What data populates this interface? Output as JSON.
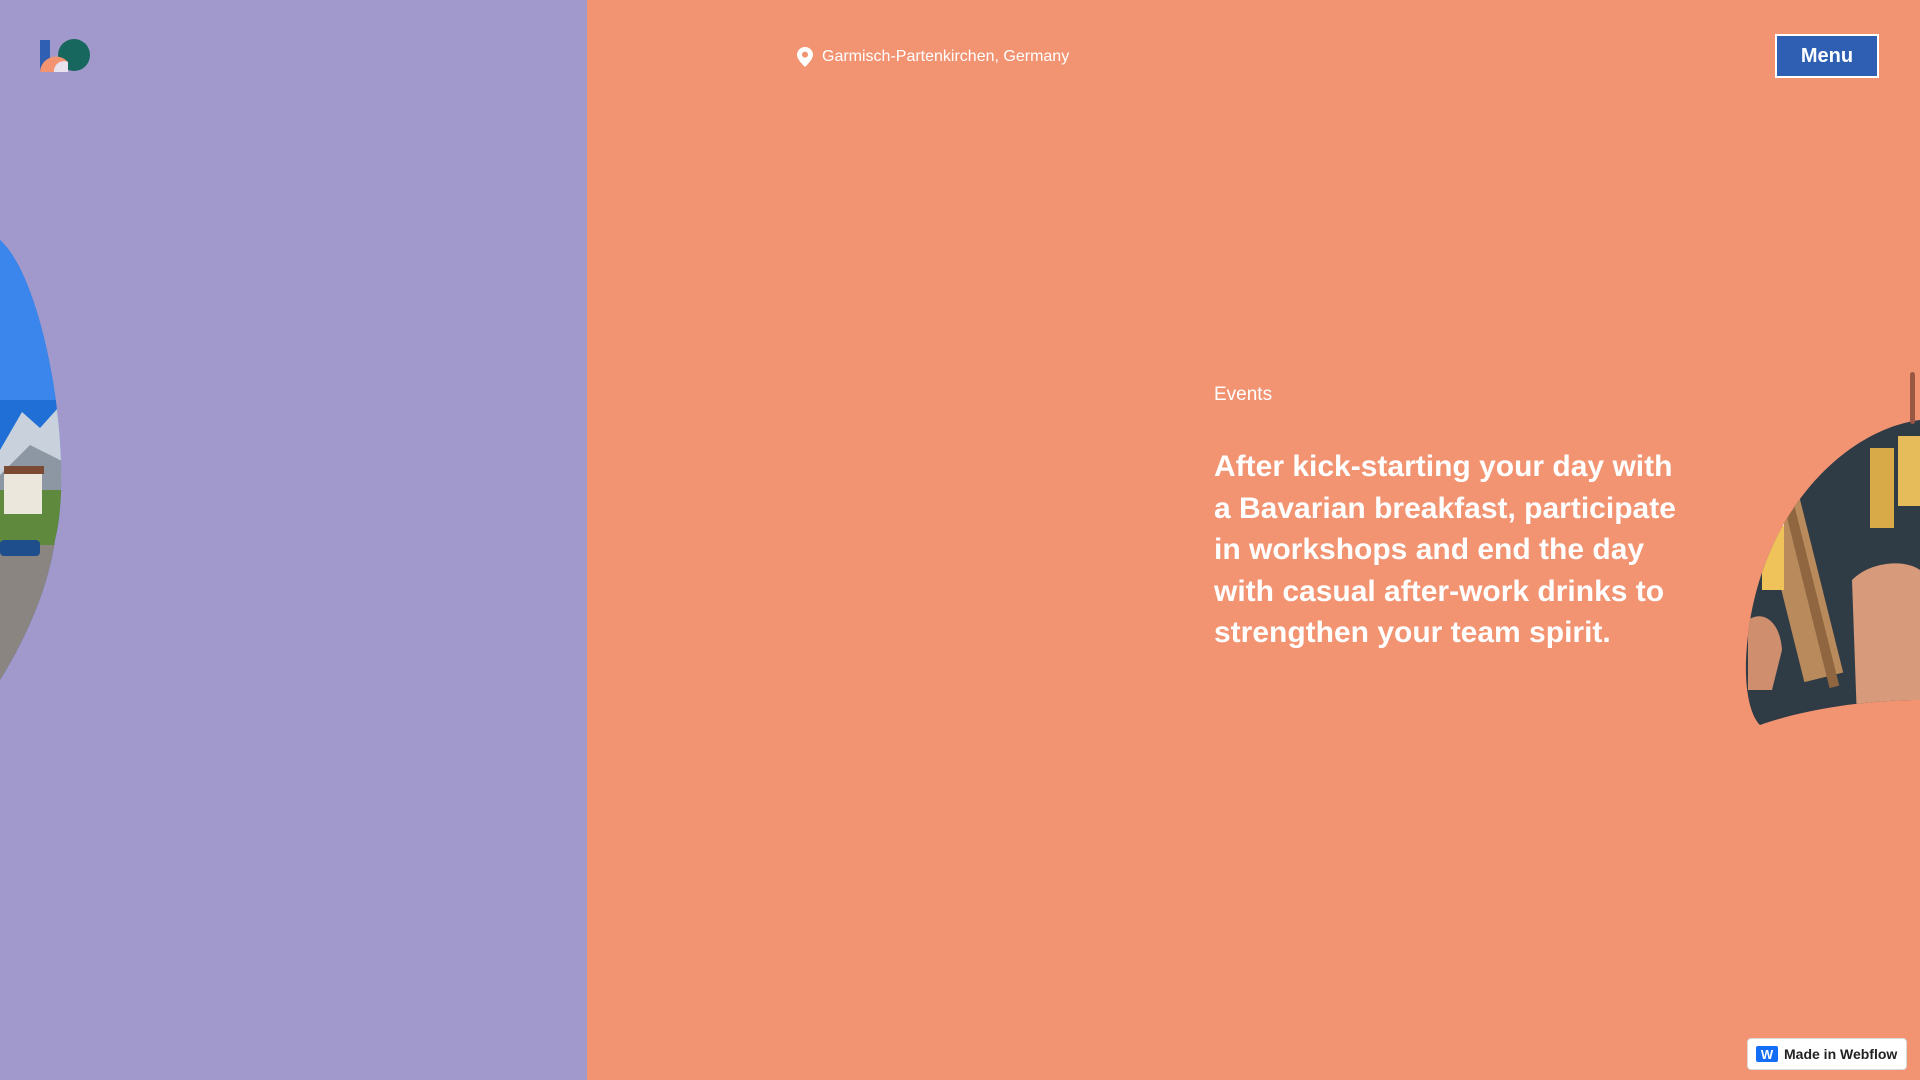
{
  "colors": {
    "left_panel": "#a199cb",
    "right_panel": "#f29372",
    "menu_button": "#2e5fb3",
    "webflow_blue": "#146ef5"
  },
  "header": {
    "logo_icon": "logo-shapes",
    "location_icon": "map-pin-icon",
    "location": "Garmisch-Partenkirchen, Germany",
    "menu_label": "Menu"
  },
  "section": {
    "eyebrow": "Events",
    "headline": "After kick-starting your day with a Bavarian breakfast, participate in workshops and end the day with casual after-work drinks to strengthen your team spirit."
  },
  "badge": {
    "icon": "webflow-logo-icon",
    "icon_glyph": "W",
    "label": "Made in Webflow"
  }
}
